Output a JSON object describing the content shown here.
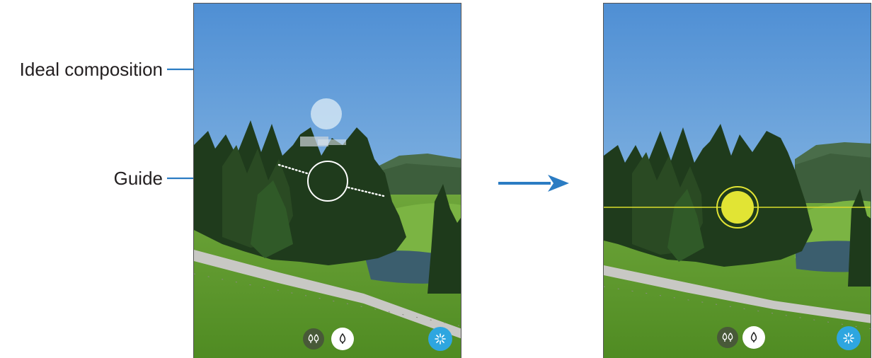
{
  "callouts": {
    "ideal_composition": "Ideal composition",
    "guide": "Guide"
  },
  "colors": {
    "sky_top": "#4f8fd4",
    "sky_bottom": "#a7cdea",
    "grass": "#5f9a2c",
    "tree": "#1f3b1c",
    "guide_ring": "#ffffff",
    "aligned_circle": "#e1e434",
    "aligned_line": "#d9dc2c",
    "shutter_button": "#2ea6e0",
    "arrow": "#2b7cc3",
    "leader_line": "#2b7cc3"
  },
  "icons": {
    "flow_arrow": "arrow-right-icon",
    "scene_mode_left": "tree-outline-icon",
    "scene_mode_right": "leaf-drop-icon",
    "shutter": "shutter-aperture-icon"
  }
}
